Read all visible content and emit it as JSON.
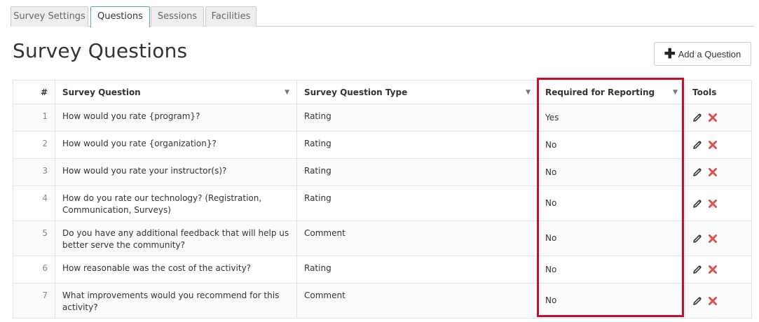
{
  "tabs": [
    {
      "label": "Survey Settings",
      "active": false
    },
    {
      "label": "Questions",
      "active": true
    },
    {
      "label": "Sessions",
      "active": false
    },
    {
      "label": "Facilities",
      "active": false
    }
  ],
  "page": {
    "title": "Survey Questions",
    "add_button_label": "Add a Question"
  },
  "table": {
    "headers": {
      "num": "#",
      "question": "Survey Question",
      "type": "Survey Question Type",
      "required": "Required for Reporting",
      "tools": "Tools"
    },
    "rows": [
      {
        "num": "1",
        "question": "How would you rate {program}?",
        "type": "Rating",
        "required": "Yes"
      },
      {
        "num": "2",
        "question": "How would you rate {organization}?",
        "type": "Rating",
        "required": "No"
      },
      {
        "num": "3",
        "question": "How would you rate your instructor(s)?",
        "type": "Rating",
        "required": "No"
      },
      {
        "num": "4",
        "question": "How do you rate our technology? (Registration, Communication, Surveys)",
        "type": "Rating",
        "required": "No"
      },
      {
        "num": "5",
        "question": "Do you have any additional feedback that will help us better serve the community?",
        "type": "Comment",
        "required": "No"
      },
      {
        "num": "6",
        "question": "How reasonable was the cost of the activity?",
        "type": "Rating",
        "required": "No"
      },
      {
        "num": "7",
        "question": "What improvements would you recommend for this activity?",
        "type": "Comment",
        "required": "No"
      }
    ]
  },
  "colors": {
    "highlight": "#c4102e",
    "delete": "#d9534f",
    "tab_active_border": "#5aa7b8"
  },
  "icons": {
    "add": "plus-icon",
    "edit": "pencil-icon",
    "delete": "delete-icon",
    "sort": "chevron-down-icon"
  }
}
